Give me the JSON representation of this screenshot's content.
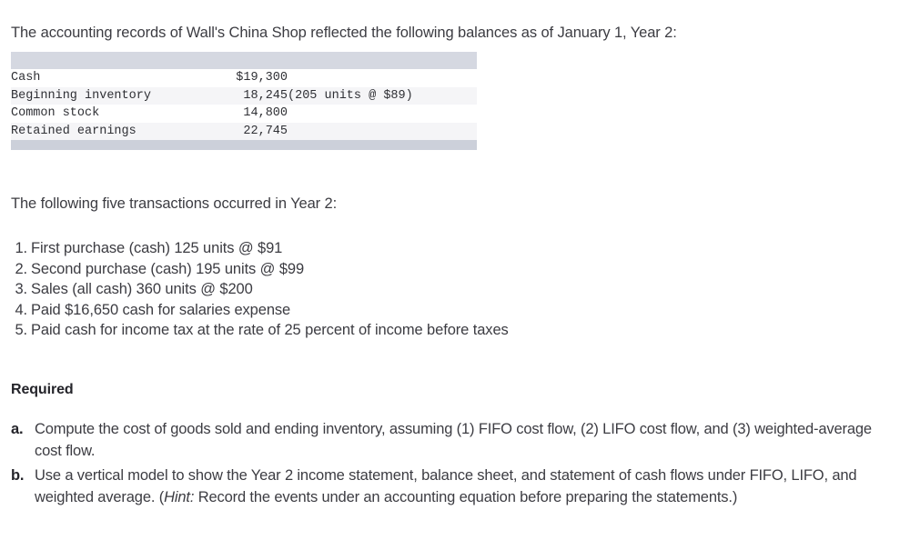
{
  "intro": {
    "text": "The accounting records of Wall's China Shop reflected the following balances as of January 1, Year 2:"
  },
  "balances_table": {
    "rows": [
      {
        "label": "Cash",
        "amount": "$19,300",
        "note": ""
      },
      {
        "label": "Beginning inventory",
        "amount": "18,245",
        "note": "(205 units @ $89)"
      },
      {
        "label": "Common stock",
        "amount": "14,800",
        "note": ""
      },
      {
        "label": "Retained earnings",
        "amount": "22,745",
        "note": ""
      }
    ],
    "header_band_color": "#d5d8e1",
    "footer_band_color": "#ccd0da",
    "stripe_color": "#f5f5f7"
  },
  "transactions_intro": {
    "text": "The following five transactions occurred in Year 2:"
  },
  "transactions": [
    {
      "num": "1.",
      "text": "First purchase (cash) 125 units @ $91"
    },
    {
      "num": "2.",
      "text": "Second purchase (cash) 195 units @ $99"
    },
    {
      "num": "3.",
      "text": "Sales (all cash) 360 units @ $200"
    },
    {
      "num": "4.",
      "text": "Paid $16,650 cash for salaries expense"
    },
    {
      "num": "5.",
      "text": "Paid cash for income tax at the rate of 25 percent of income before taxes"
    }
  ],
  "required": {
    "heading": "Required",
    "items": [
      {
        "marker": "a.",
        "text": "Compute the cost of goods sold and ending inventory, assuming (1) FIFO cost flow, (2) LIFO cost flow, and (3) weighted-average cost flow."
      },
      {
        "marker": "b.",
        "text_before_hint": "Use a vertical model to show the Year 2 income statement, balance sheet, and statement of cash flows under FIFO, LIFO, and weighted average. (",
        "hint_label": "Hint:",
        "text_after_hint": " Record the events under an accounting equation before preparing the statements.)"
      }
    ]
  },
  "colors": {
    "body_text": "#3c3c42",
    "heading_text": "#24242a",
    "table_text": "#2f3035",
    "page_background": "#ffffff"
  }
}
